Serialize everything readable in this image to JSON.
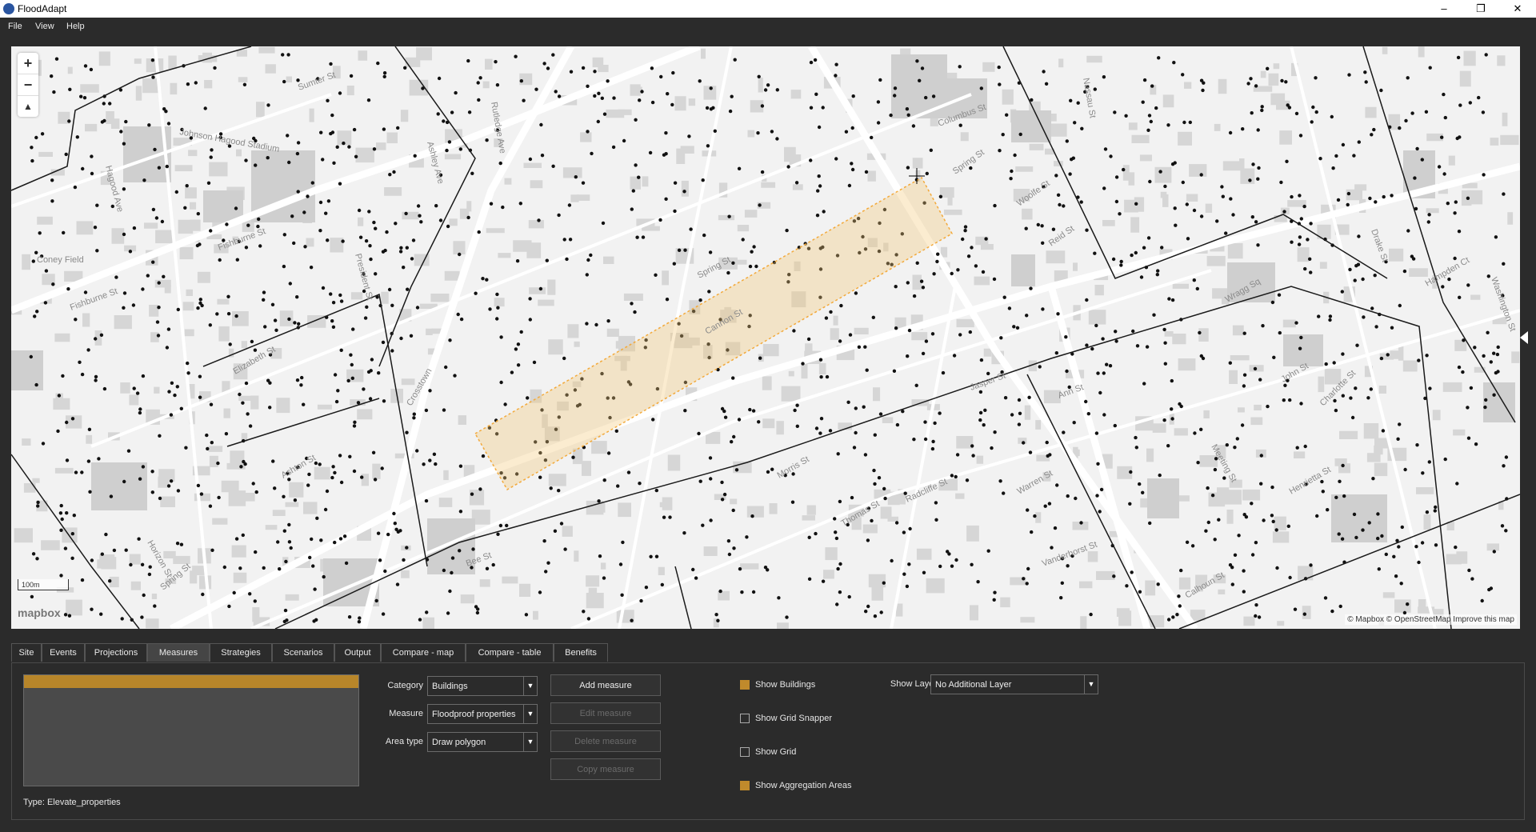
{
  "window": {
    "title": "FloodAdapt",
    "minimize": "–",
    "restore": "❐",
    "close": "✕"
  },
  "menu": [
    "File",
    "View",
    "Help"
  ],
  "map": {
    "zoom_in": "+",
    "zoom_out": "−",
    "compass": "▲",
    "scale": "100m",
    "logo": "mapbox",
    "attribution": "© Mapbox © OpenStreetMap Improve this map",
    "streets": [
      "Sumter St",
      "Hagood Ave",
      "Fishburne St",
      "Fishburne St",
      "President St",
      "Ashley Ave",
      "Rutledge Ave",
      "Columbus St",
      "Spring St",
      "Cannon St",
      "Spring St",
      "Woolfe St",
      "Reid St",
      "Nassau St",
      "Meeting St",
      "Charlotte St",
      "Henrietta St",
      "Wragg Sq",
      "John St",
      "Ann St",
      "Radcliffe St",
      "Warren St",
      "Vanderhorst St",
      "Bee St",
      "Horizon St",
      "Spring St",
      "Calhoun St",
      "Crosstown",
      "Johnson Hagood Stadium",
      "Coney Field",
      "Elizabeth St",
      "Ashton St",
      "Morris St",
      "Thomas St",
      "Drake St",
      "Washington St",
      "Hampden Ct",
      "Jasper St"
    ]
  },
  "tabs": [
    "Site",
    "Events",
    "Projections",
    "Measures",
    "Strategies",
    "Scenarios",
    "Output",
    "Compare - map",
    "Compare - table",
    "Benefits"
  ],
  "active_tab": "Measures",
  "measures": {
    "type_text": "Type: Elevate_properties",
    "category_label": "Category",
    "category_value": "Buildings",
    "measure_label": "Measure",
    "measure_value": "Floodproof properties",
    "area_label": "Area type",
    "area_value": "Draw polygon",
    "add_button": "Add measure",
    "edit_button": "Edit measure",
    "delete_button": "Delete measure",
    "copy_button": "Copy measure",
    "show_buildings": "Show Buildings",
    "show_grid_snapper": "Show Grid Snapper",
    "show_grid": "Show Grid",
    "show_aggregation": "Show Aggregation Areas",
    "show_layer_label": "Show Layer",
    "show_layer_value": "No Additional Layer",
    "arrow": "▼"
  },
  "colors": {
    "accent": "#c08a2c",
    "selection": "#b8862a",
    "polygon": "#f3a93a"
  }
}
